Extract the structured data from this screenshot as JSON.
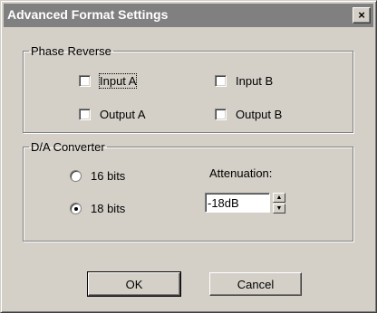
{
  "window": {
    "title": "Advanced Format Settings",
    "close_glyph": "×"
  },
  "phase_reverse": {
    "legend": "Phase Reverse",
    "input_a": {
      "label": "Input A",
      "checked": false
    },
    "input_b": {
      "label": "Input B",
      "checked": false
    },
    "output_a": {
      "label": "Output A",
      "checked": false
    },
    "output_b": {
      "label": "Output B",
      "checked": false
    }
  },
  "da_converter": {
    "legend": "D/A Converter",
    "bits_16": {
      "label": "16 bits",
      "selected": false
    },
    "bits_18": {
      "label": "18 bits",
      "selected": true
    },
    "attenuation_label": "Attenuation:",
    "attenuation_value": "-18dB"
  },
  "buttons": {
    "ok": "OK",
    "cancel": "Cancel"
  },
  "icons": {
    "spin_up": "▲",
    "spin_down": "▼"
  }
}
